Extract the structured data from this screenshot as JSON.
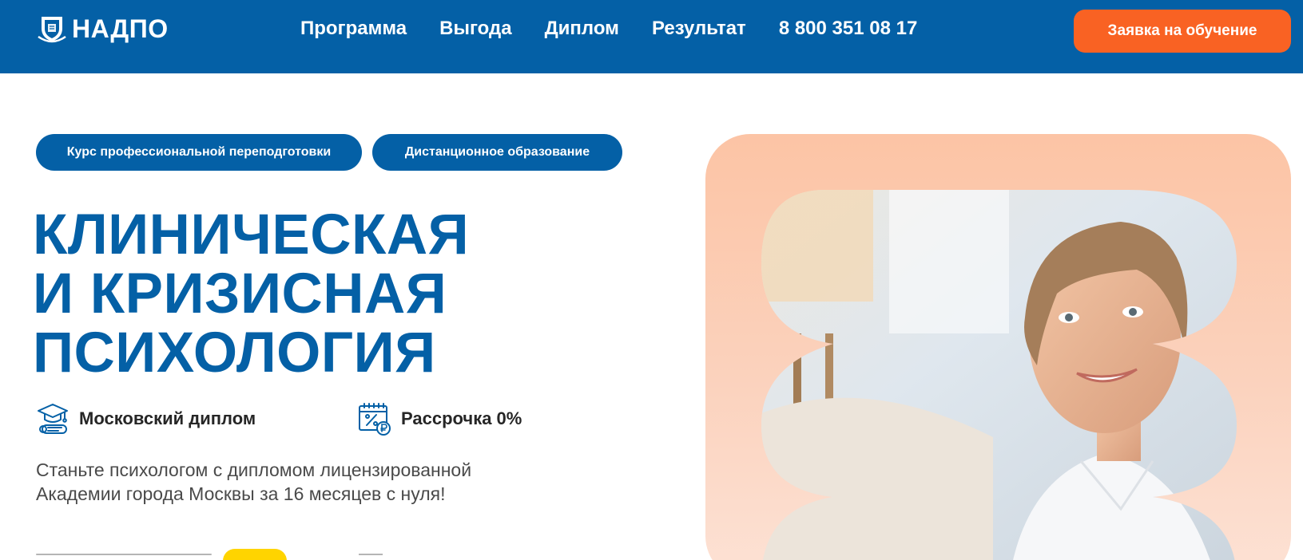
{
  "header": {
    "logo_text": "НАДПО",
    "nav": [
      "Программа",
      "Выгода",
      "Диплом",
      "Результат"
    ],
    "phone": "8 800 351 08 17",
    "cta_label": "Заявка на обучение"
  },
  "tags": [
    "Курс профессиональной переподготовки",
    "Дистанционное образование"
  ],
  "title_lines": [
    "КЛИНИЧЕСКАЯ",
    "И КРИЗИСНАЯ",
    "ПСИХОЛОГИЯ"
  ],
  "features": [
    {
      "icon": "graduation-cap-diploma-icon",
      "label": "Московский диплом"
    },
    {
      "icon": "calendar-percent-ruble-icon",
      "label": "Рассрочка 0%"
    }
  ],
  "description": "Станьте психологом с дипломом лицензированной Академии города Москвы за 16 месяцев с нуля!",
  "colors": {
    "primary": "#0460a6",
    "accent": "#f96223",
    "highlight": "#ffd400",
    "hero_bg": "#fcc4a5"
  }
}
